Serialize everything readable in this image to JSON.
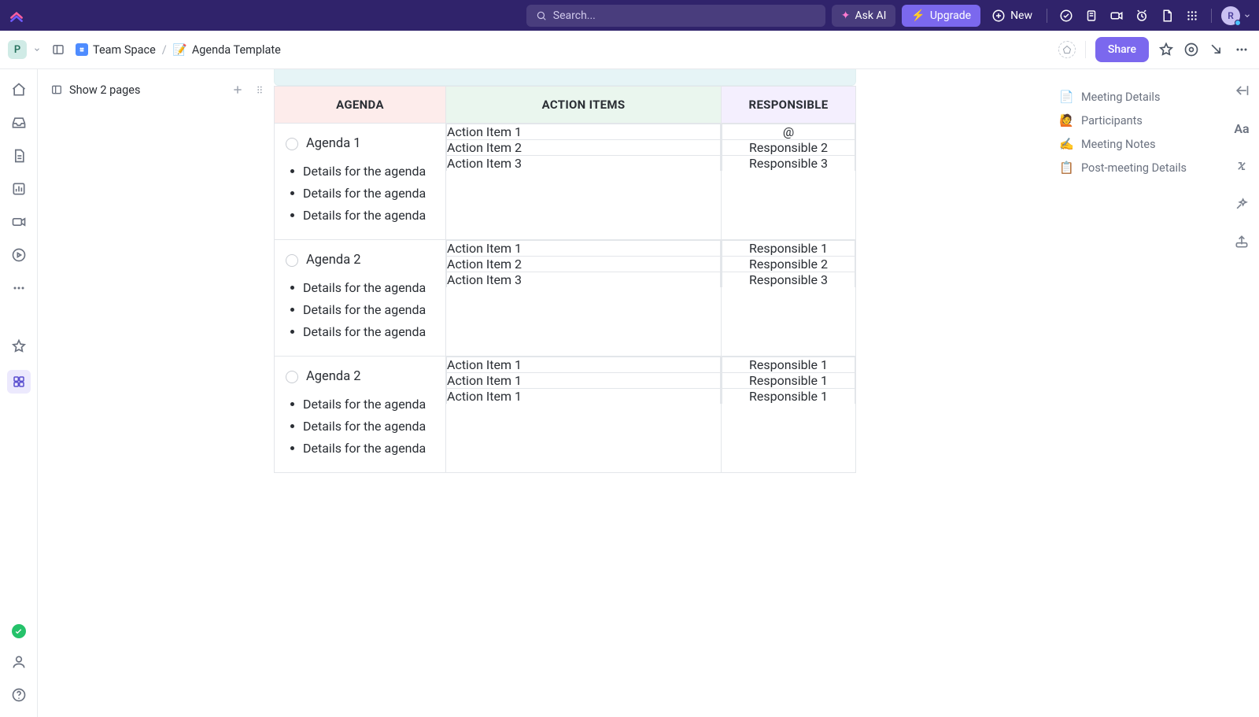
{
  "topbar": {
    "search_placeholder": "Search...",
    "ask_ai": "Ask AI",
    "upgrade": "Upgrade",
    "new": "New",
    "avatar_initial": "R"
  },
  "subheader": {
    "workspace_initial": "P",
    "breadcrumb_space": "Team Space",
    "breadcrumb_sep": "/",
    "breadcrumb_doc_emoji": "📝",
    "breadcrumb_doc": "Agenda Template",
    "share": "Share"
  },
  "pages_panel": {
    "show_label": "Show 2 pages"
  },
  "table": {
    "headers": {
      "agenda": "AGENDA",
      "action_items": "ACTION ITEMS",
      "responsible": "RESPONSIBLE"
    },
    "rows": [
      {
        "title": "Agenda 1",
        "details": [
          "Details for the agen­da",
          "Details for the agen­da",
          "Details for the agen­da"
        ],
        "actions": [
          "Action Item 1",
          "Action Item 2",
          "Action Item 3"
        ],
        "responsible": [
          "@",
          "Responsible 2",
          "Responsible 3"
        ]
      },
      {
        "title": "Agenda 2",
        "details": [
          "Details for the agen­da",
          "Details for the agen­da",
          "Details for the agen­da"
        ],
        "actions": [
          "Action Item 1",
          "Action Item 2",
          "Action Item 3"
        ],
        "responsible": [
          "Responsible 1",
          "Responsible 2",
          "Responsible 3"
        ]
      },
      {
        "title": "Agenda 2",
        "details": [
          "Details for the agen­da",
          "Details for the agen­da",
          "Details for the agen­da"
        ],
        "actions": [
          "Action Item 1",
          "Action Item 1",
          "Action Item 1"
        ],
        "responsible": [
          "Responsible 1",
          "Responsible 1",
          "Responsible 1"
        ]
      }
    ]
  },
  "outline": [
    {
      "emoji": "📄",
      "label": "Meeting Details"
    },
    {
      "emoji": "🙋",
      "label": "Participants"
    },
    {
      "emoji": "✍️",
      "label": "Meeting Notes"
    },
    {
      "emoji": "📋",
      "label": "Post-meeting Details"
    }
  ]
}
